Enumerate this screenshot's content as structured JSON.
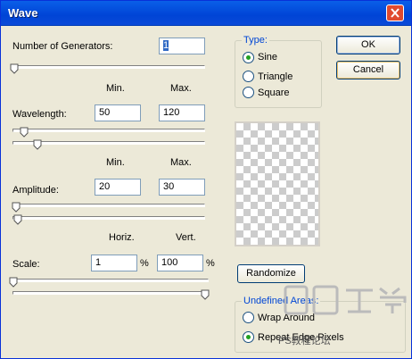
{
  "window": {
    "title": "Wave"
  },
  "generators": {
    "label": "Number of Generators:",
    "value": "1",
    "slider_fraction": 0.0
  },
  "col_headers_1": {
    "min": "Min.",
    "max": "Max."
  },
  "wavelength": {
    "label": "Wavelength:",
    "min": "50",
    "max": "120",
    "slider_min_fraction": 0.05,
    "slider_max_fraction": 0.12
  },
  "col_headers_2": {
    "min": "Min.",
    "max": "Max."
  },
  "amplitude": {
    "label": "Amplitude:",
    "min": "20",
    "max": "30",
    "slider_min_fraction": 0.01,
    "slider_max_fraction": 0.01
  },
  "col_headers_3": {
    "horiz": "Horiz.",
    "vert": "Vert."
  },
  "scale": {
    "label": "Scale:",
    "horiz": "1",
    "vert": "100",
    "unit": "%",
    "slider_horiz_fraction": 0.0,
    "slider_vert_fraction": 1.0
  },
  "type_group": {
    "label": "Type:",
    "options": [
      {
        "label": "Sine",
        "selected": true
      },
      {
        "label": "Triangle",
        "selected": false
      },
      {
        "label": "Square",
        "selected": false
      }
    ]
  },
  "buttons": {
    "ok": "OK",
    "cancel": "Cancel",
    "randomize": "Randomize"
  },
  "undefined_areas": {
    "label": "Undefined Areas:",
    "options": [
      {
        "label": "Wrap Around",
        "selected": false
      },
      {
        "label": "Repeat Edge Pixels",
        "selected": true
      }
    ]
  },
  "watermark": {
    "text": "PS教程论坛"
  },
  "colors": {
    "title_bar": "#0a5fe8",
    "dialog_bg": "#ece9d8",
    "group_label": "#0046d5",
    "radio_dot": "#21a121"
  }
}
